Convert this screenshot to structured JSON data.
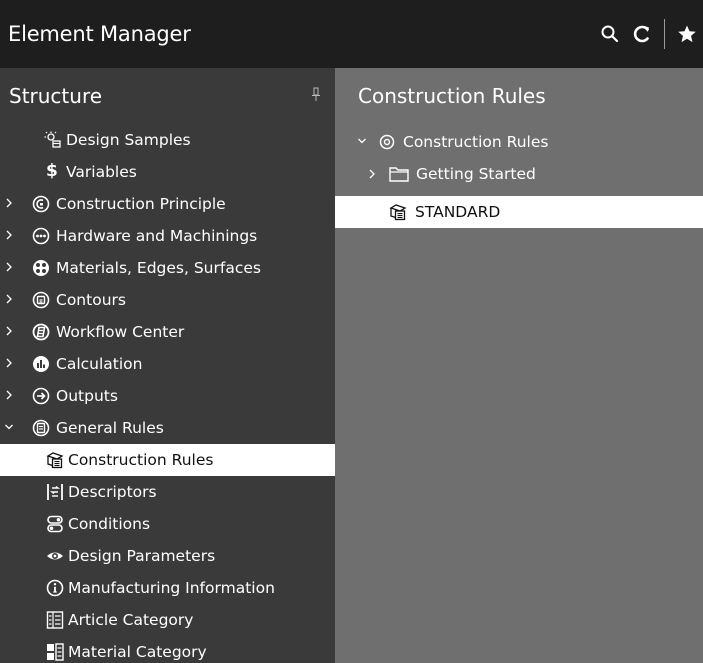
{
  "app": {
    "title": "Element Manager"
  },
  "toolbar": {
    "search_icon": "search-icon",
    "refresh_icon": "refresh-icon",
    "favorite_icon": "star-icon"
  },
  "colors": {
    "background": "#1e1e1e",
    "left_panel": "#3a3a3a",
    "right_panel": "#6f6f6f",
    "selection": "#ffffff"
  },
  "left": {
    "title": "Structure",
    "items": [
      {
        "label": "Design Samples",
        "icon": "design-samples-icon",
        "expandable": false
      },
      {
        "label": "Variables",
        "icon": "dollar-icon",
        "expandable": false
      },
      {
        "label": "Construction Principle",
        "icon": "construction-principle-icon",
        "expandable": true,
        "expanded": false
      },
      {
        "label": "Hardware and Machinings",
        "icon": "hardware-icon",
        "expandable": true,
        "expanded": false
      },
      {
        "label": "Materials, Edges, Surfaces",
        "icon": "materials-icon",
        "expandable": true,
        "expanded": false
      },
      {
        "label": "Contours",
        "icon": "contours-icon",
        "expandable": true,
        "expanded": false
      },
      {
        "label": "Workflow Center",
        "icon": "workflow-icon",
        "expandable": true,
        "expanded": false
      },
      {
        "label": "Calculation",
        "icon": "calculation-icon",
        "expandable": true,
        "expanded": false
      },
      {
        "label": "Outputs",
        "icon": "outputs-icon",
        "expandable": true,
        "expanded": false
      },
      {
        "label": "General Rules",
        "icon": "general-rules-icon",
        "expandable": true,
        "expanded": true
      },
      {
        "label": "Construction Rules",
        "icon": "construction-rules-icon",
        "expandable": false,
        "selected": true
      },
      {
        "label": "Descriptors",
        "icon": "descriptors-icon",
        "expandable": false
      },
      {
        "label": "Conditions",
        "icon": "conditions-icon",
        "expandable": false
      },
      {
        "label": "Design Parameters",
        "icon": "eye-icon",
        "expandable": false
      },
      {
        "label": "Manufacturing Information",
        "icon": "info-icon",
        "expandable": false
      },
      {
        "label": "Article Category",
        "icon": "article-category-icon",
        "expandable": false
      },
      {
        "label": "Material Category",
        "icon": "material-category-icon",
        "expandable": false
      }
    ]
  },
  "right": {
    "title": "Construction Rules",
    "items": [
      {
        "label": "Construction Rules",
        "icon": "target-icon",
        "expanded": true
      },
      {
        "label": "Getting Started",
        "icon": "folder-icon",
        "expanded": false
      },
      {
        "label": "STANDARD",
        "icon": "construction-rules-icon",
        "selected": true
      }
    ]
  }
}
